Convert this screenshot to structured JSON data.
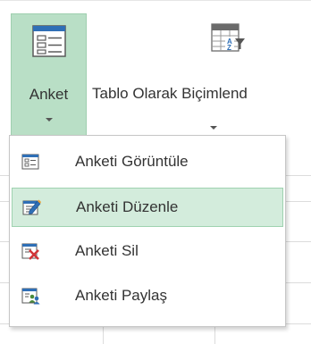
{
  "ribbon": {
    "anket_button": {
      "label": "Anket",
      "icon": "form-icon"
    },
    "tablo_button": {
      "label": "Tablo Olarak Biçimlend",
      "icon": "format-as-table-icon"
    }
  },
  "menu": {
    "items": [
      {
        "label": "Anketi Görüntüle",
        "icon": "view-survey-icon"
      },
      {
        "label": "Anketi Düzenle",
        "icon": "edit-survey-icon"
      },
      {
        "label": "Anketi Sil",
        "icon": "delete-survey-icon"
      },
      {
        "label": "Anketi Paylaş",
        "icon": "share-survey-icon"
      }
    ]
  },
  "colors": {
    "selected_button_bg": "#b9dfc6",
    "hover_item_bg": "#d3ecdc",
    "icon_blue": "#2f6fb6",
    "delete_red": "#d13438"
  }
}
